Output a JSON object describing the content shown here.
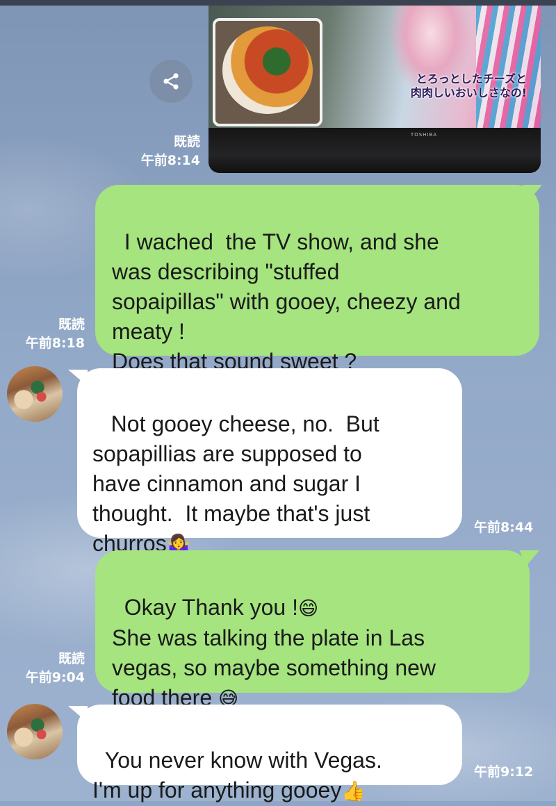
{
  "photo_message": {
    "tv_caption": "とろっとしたチーズと\n肉肉しいおいしさなの!",
    "tv_brand": "TOSHIBA",
    "read_label": "既読",
    "time": "午前8:14"
  },
  "messages": [
    {
      "side": "sent",
      "text": "I wached  the TV show, and she\nwas describing \"stuffed\nsopaipillas\" with gooey, cheezy and\nmeaty !\nDoes that sound sweet ?",
      "read_label": "既読",
      "time": "午前8:18"
    },
    {
      "side": "received",
      "text": " Not gooey cheese, no.  But\nsopapillias are supposed to\nhave cinnamon and sugar I\nthought.  It maybe that's just\nchurros",
      "emoji": "🤷‍♀️",
      "time": "午前8:44"
    },
    {
      "side": "sent",
      "text_line1": "Okay Thank you !",
      "emoji1": "😄",
      "text_rest": "She was talking the plate in Las\nvegas, so maybe something new\nfood there ",
      "emoji2": "😅",
      "read_label": "既読",
      "time": "午前9:04"
    },
    {
      "side": "received",
      "text": "You never know with Vegas.\nI'm up for anything gooey",
      "emoji": "👍",
      "time": "午前9:12"
    }
  ],
  "icons": {
    "share": "share-icon",
    "avatar": "contact-avatar"
  },
  "colors": {
    "sent_bubble": "#a5e47f",
    "received_bubble": "#ffffff",
    "background": "#8fa5c5",
    "meta_text": "#ffffff"
  }
}
